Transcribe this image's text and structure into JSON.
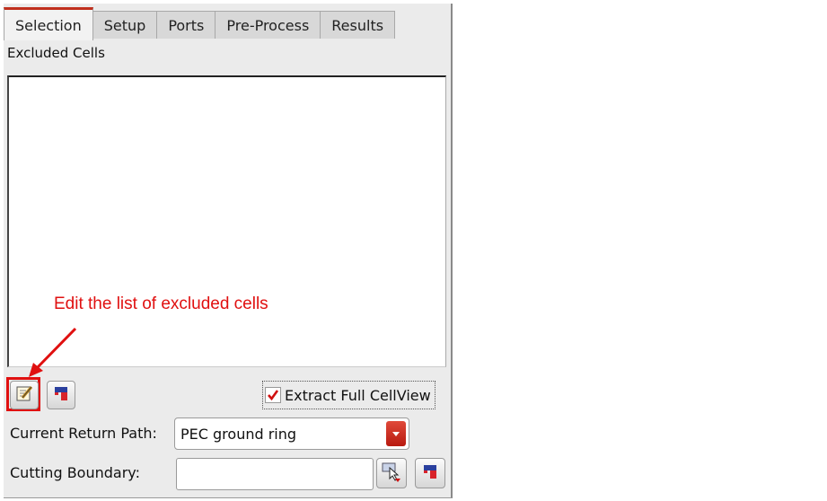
{
  "tabs": [
    {
      "label": "Selection",
      "active": true
    },
    {
      "label": "Setup",
      "active": false
    },
    {
      "label": "Ports",
      "active": false
    },
    {
      "label": "Pre-Process",
      "active": false
    },
    {
      "label": "Results",
      "active": false
    }
  ],
  "excluded_cells": {
    "label": "Excluded Cells",
    "items": []
  },
  "annotation": {
    "text": "Edit the list of excluded cells",
    "color": "#e01010"
  },
  "toolbar": {
    "edit_icon": "edit-list-icon",
    "clear_icon": "clear-eraser-icon"
  },
  "extract_full": {
    "label": "Extract Full CellView",
    "checked": true
  },
  "return_path": {
    "label": "Current Return Path:",
    "value": "PEC ground ring"
  },
  "cutting_boundary": {
    "label": "Cutting Boundary:",
    "value": "",
    "select_icon": "select-pointer-icon",
    "clear_icon": "clear-eraser-icon"
  },
  "colors": {
    "active_tab_accent": "#c0301e",
    "combo_arrow": "#c62a1c",
    "check_mark": "#d01010"
  }
}
